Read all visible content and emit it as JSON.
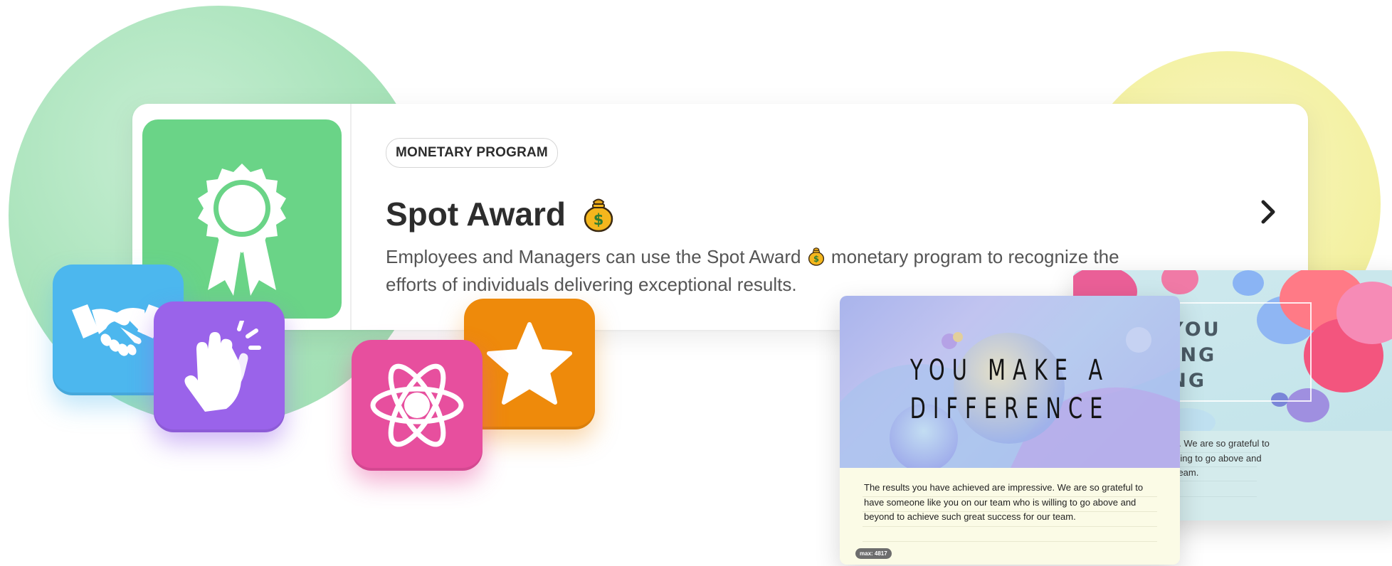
{
  "program_card": {
    "badge_label": "MONETARY PROGRAM",
    "title": "Spot Award",
    "title_emoji_icon": "money-bag-icon",
    "description": {
      "part1": "Employees and Managers can use the Spot Award",
      "part2": "monetary program to recognize the",
      "line2": "efforts of individuals delivering exceptional results."
    },
    "award_icon": "award-ribbon-icon",
    "award_tile_color": "#6ad487",
    "chevron_icon": "chevron-right-icon"
  },
  "feature_tiles": [
    {
      "icon": "handshake-icon",
      "color": "#4cb7ee"
    },
    {
      "icon": "clapping-hands-icon",
      "color": "#9a63ea"
    },
    {
      "icon": "star-icon",
      "color": "#ee8a0b"
    },
    {
      "icon": "atom-icon",
      "color": "#e74f9e"
    }
  ],
  "ecards": {
    "front": {
      "headline_line1": "YOU MAKE A",
      "headline_line2": "DIFFERENCE",
      "message": "The results you have achieved are impressive. We are so grateful to have someone like you on our team who is willing to go above and beyond to achieve such great success for our team.",
      "max_label": "max: 4817"
    },
    "back": {
      "headline_line1": "THANK YOU",
      "headline_line2": "FOR BEING",
      "headline_line3": "AMAZING",
      "message_line1": "achieved are impressive. We are so grateful to",
      "message_line2": "u on our team who is willing to go above and",
      "message_line3": "h great success for our team."
    }
  },
  "colors": {
    "background_green": "#a6e2b8",
    "background_yellow": "#f3f09e"
  }
}
